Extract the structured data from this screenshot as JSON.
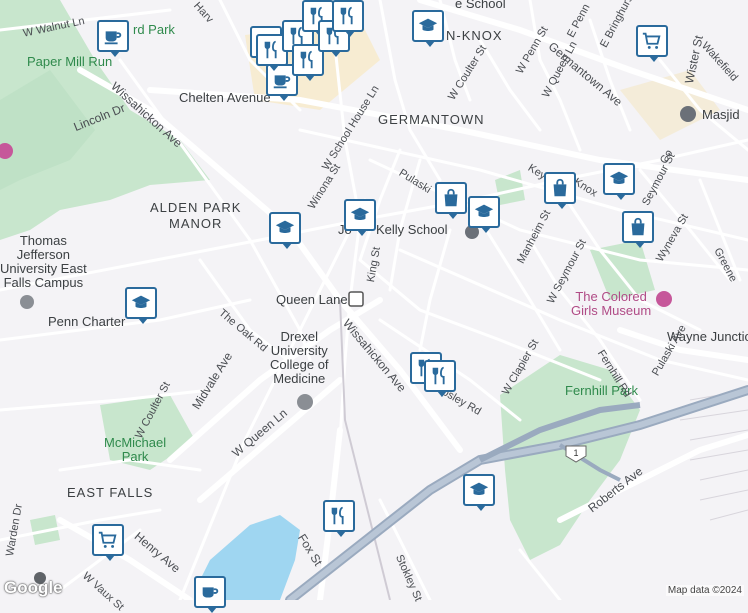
{
  "map": {
    "neighborhoods": {
      "germantown": "GERMANTOWN",
      "knox": "N-KNOX",
      "alden_park": "ALDEN PARK\nMANOR",
      "east_falls": "EAST FALLS"
    },
    "parks": {
      "fernhill": "Fernhill Park",
      "mcmichael": "McMichael\nPark",
      "bird_park": "rd Park",
      "paper_mill": "Paper Mill Run"
    },
    "places": {
      "thomas_jefferson": "Thomas\nJefferson\nUniversity East\nFalls Campus",
      "penn_charter": "Penn Charter",
      "drexel": "Drexel\nUniversity\nCollege of\nMedicine",
      "kelly_school": "Kelly School",
      "colored_girls": "The Colored\nGirls Museum",
      "masjid": "Masjid",
      "queen_lane": "Queen Lane",
      "wayne_junction": "Wayne Junction",
      "chelten": "Chelten Avenue",
      "jo": "Jo",
      "school_top": "e School"
    },
    "streets": {
      "w_walnut": "W Walnut Ln",
      "lincoln": "Lincoln Dr",
      "wissahickon_top": "Wissahickon Ave",
      "wissahickon_mid": "Wissahickon Ave",
      "w_school_house": "W School House Ln",
      "winona": "Winona St",
      "king": "King St",
      "pulaski_top": "Pulaski",
      "pulaski_ave": "Pulaski Ave",
      "w_coulter_top": "W Coulter St",
      "w_coulter_low": "W Coulter St",
      "w_penn": "W Penn St",
      "w_queen_top": "W Queen Ln",
      "w_queen_low": "W Queen Ln",
      "germantown_ave": "Germantown Ave",
      "wister": "Wister St",
      "wakefield": "Wakefield",
      "e_penn": "E Penn",
      "e_bringhurst": "E Bringhurs",
      "keyser": "Key",
      "knox": "Knox",
      "seymour_top": "Seymour St",
      "manheim": "Manheim St",
      "w_seymour": "W Seymour St",
      "wyneva": "Wyneva St",
      "greene": "Greene",
      "the_oak": "The Oak Rd",
      "midvale": "Midvale Ave",
      "fernhill_rd": "Fernhill Rd",
      "w_clapier": "W Clapier St",
      "apsley": "psley Rd",
      "roberts": "Roberts Ave",
      "henry": "Henry Ave",
      "fox": "Fox St",
      "stokley": "Stokley St",
      "w_vaux": "W Vaux St",
      "warden": "Warden Dr",
      "harv": "Harv",
      "co": "Co"
    },
    "route_shield": "1",
    "attribution": "Map data ©2024",
    "logo": "Google",
    "markers": [
      {
        "type": "cafe",
        "name": "cafe-icon"
      },
      {
        "type": "school",
        "name": "school-icon"
      },
      {
        "type": "grocery",
        "name": "grocery-cart-icon"
      },
      {
        "type": "restaurant",
        "name": "restaurant-icon"
      },
      {
        "type": "shopping",
        "name": "shopping-bag-icon"
      }
    ],
    "colors": {
      "background": "#f4f3f6",
      "park": "#c8e6cd",
      "water": "#9fd6f1",
      "road": "#ffffff",
      "highway": "#a9b7c9",
      "commercial": "#f7ecd2",
      "marker_border": "#2a6a9c"
    }
  }
}
